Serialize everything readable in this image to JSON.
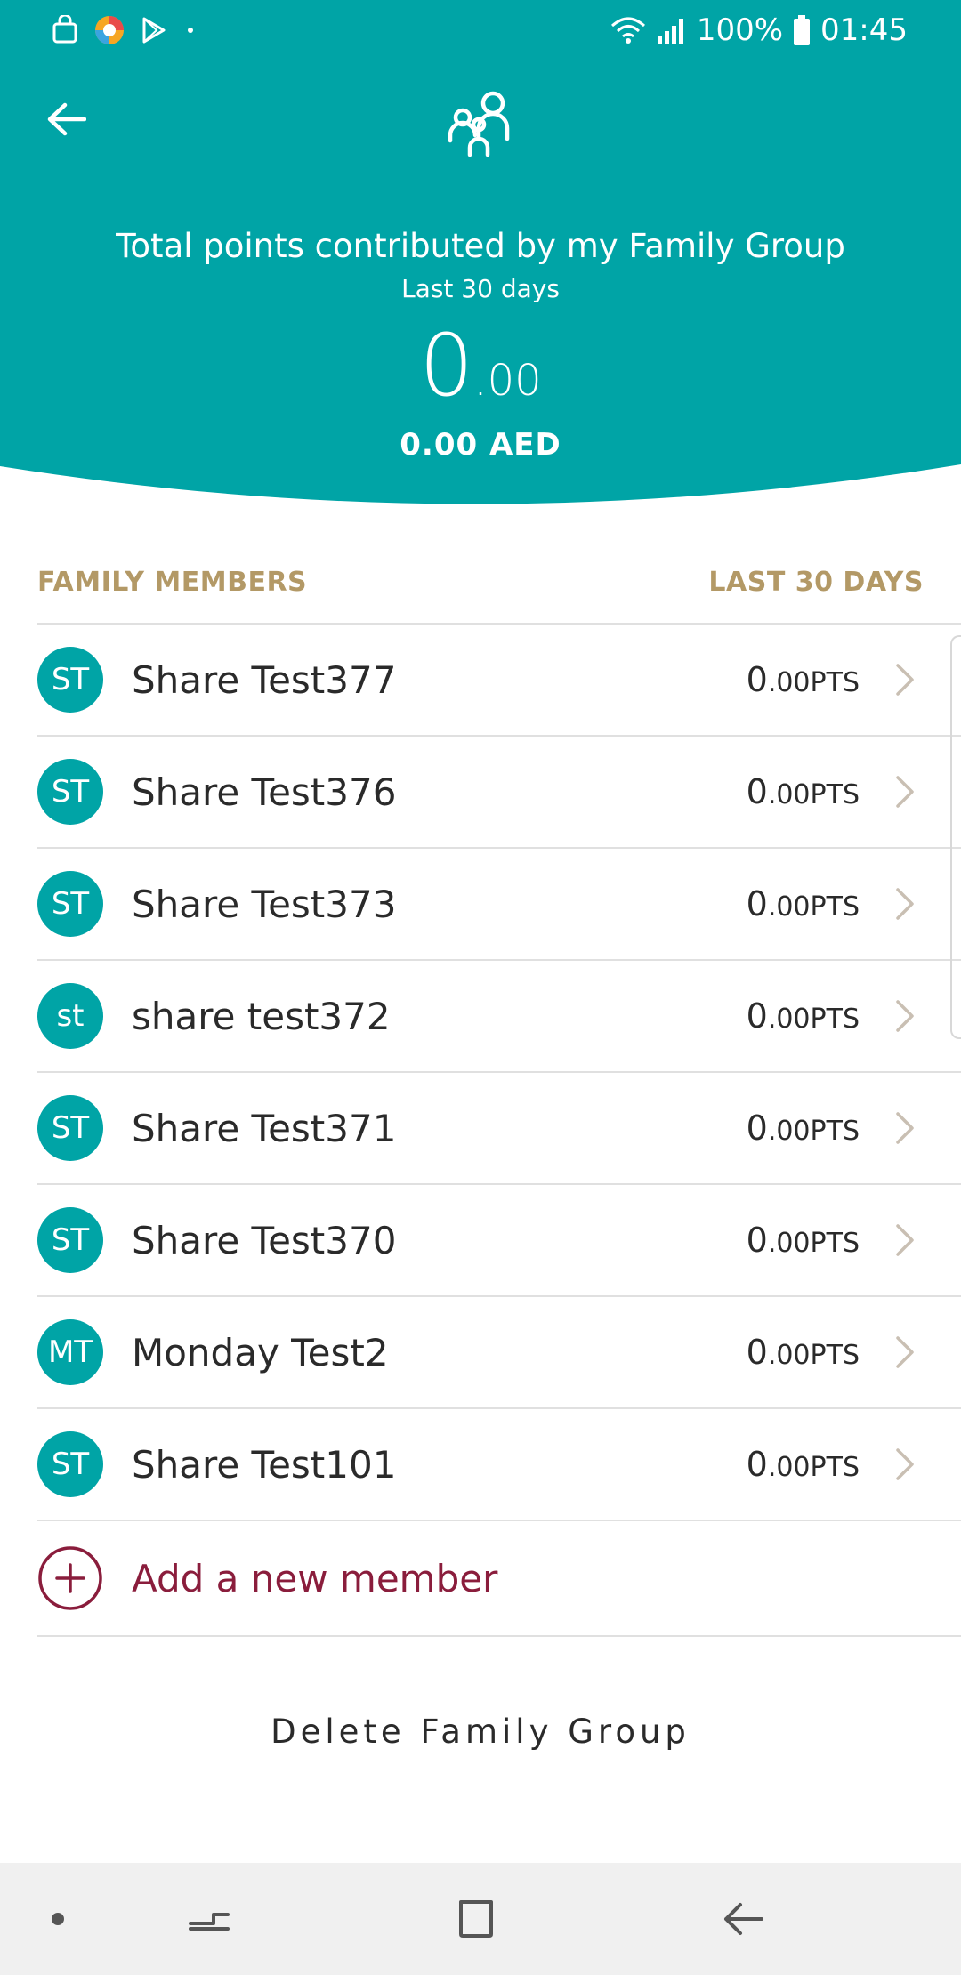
{
  "status_bar": {
    "battery": "100%",
    "time": "01:45"
  },
  "header": {
    "title": "Total points contributed by my Family Group",
    "subtitle": "Last 30 days",
    "points_int": "0",
    "points_dec": ".00",
    "aed": "0.00 AED"
  },
  "colors": {
    "brand_teal": "#00a4a6",
    "accent_gold": "#b39966",
    "accent_maroon": "#8a1d3c"
  },
  "section": {
    "left_label": "FAMILY MEMBERS",
    "right_label": "LAST 30 DAYS"
  },
  "members": [
    {
      "initials": "ST",
      "name": "Share Test377",
      "pts_int": "0",
      "pts_dec": ".00",
      "unit": "PTS"
    },
    {
      "initials": "ST",
      "name": "Share Test376",
      "pts_int": "0",
      "pts_dec": ".00",
      "unit": "PTS"
    },
    {
      "initials": "ST",
      "name": "Share Test373",
      "pts_int": "0",
      "pts_dec": ".00",
      "unit": "PTS"
    },
    {
      "initials": "st",
      "name": "share test372",
      "pts_int": "0",
      "pts_dec": ".00",
      "unit": "PTS"
    },
    {
      "initials": "ST",
      "name": "Share Test371",
      "pts_int": "0",
      "pts_dec": ".00",
      "unit": "PTS"
    },
    {
      "initials": "ST",
      "name": "Share Test370",
      "pts_int": "0",
      "pts_dec": ".00",
      "unit": "PTS"
    },
    {
      "initials": "MT",
      "name": "Monday Test2",
      "pts_int": "0",
      "pts_dec": ".00",
      "unit": "PTS"
    },
    {
      "initials": "ST",
      "name": "Share Test101",
      "pts_int": "0",
      "pts_dec": ".00",
      "unit": "PTS"
    }
  ],
  "actions": {
    "add_member": "Add a new member",
    "delete_group": "Delete Family Group"
  },
  "icons": {
    "back": "arrow-left-icon",
    "group": "family-group-icon",
    "chevron": "chevron-right-icon",
    "add": "plus-circle-icon"
  }
}
